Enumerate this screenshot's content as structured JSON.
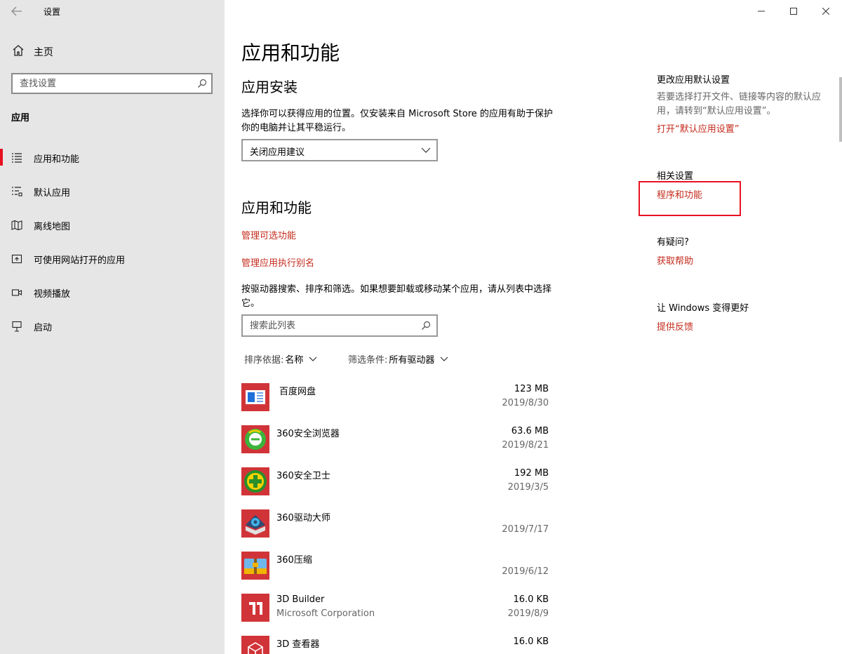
{
  "window": {
    "title": "设置"
  },
  "sidebar": {
    "home_label": "主页",
    "search_placeholder": "查找设置",
    "section_label": "应用",
    "items": [
      {
        "label": "应用和功能",
        "icon": "apps-features-icon",
        "active": true
      },
      {
        "label": "默认应用",
        "icon": "default-apps-icon",
        "active": false
      },
      {
        "label": "离线地图",
        "icon": "offline-maps-icon",
        "active": false
      },
      {
        "label": "可使用网站打开的应用",
        "icon": "apps-for-websites-icon",
        "active": false
      },
      {
        "label": "视频播放",
        "icon": "video-playback-icon",
        "active": false
      },
      {
        "label": "启动",
        "icon": "startup-icon",
        "active": false
      }
    ]
  },
  "main": {
    "title": "应用和功能",
    "install_section": {
      "heading": "应用安装",
      "description": "选择你可以获得应用的位置。仅安装来自 Microsoft Store 的应用有助于保护你的电脑并让其平稳运行。",
      "dropdown_value": "关闭应用建议"
    },
    "apps_section": {
      "heading": "应用和功能",
      "link_optional": "管理可选功能",
      "link_alias": "管理应用执行别名",
      "description": "按驱动器搜索、排序和筛选。如果想要卸载或移动某个应用，请从列表中选择它。",
      "search_placeholder": "搜索此列表",
      "sort_key": "排序依据:",
      "sort_value": "名称",
      "filter_key": "筛选条件:",
      "filter_value": "所有驱动器"
    },
    "apps": [
      {
        "name": "百度网盘",
        "publisher": "",
        "size": "123 MB",
        "date": "2019/8/30",
        "icon": "baidu-netdisk-icon"
      },
      {
        "name": "360安全浏览器",
        "publisher": "",
        "size": "63.6 MB",
        "date": "2019/8/21",
        "icon": "360-browser-icon"
      },
      {
        "name": "360安全卫士",
        "publisher": "",
        "size": "192 MB",
        "date": "2019/3/5",
        "icon": "360-safe-icon"
      },
      {
        "name": "360驱动大师",
        "publisher": "",
        "size": "",
        "date": "2019/7/17",
        "icon": "360-driver-icon"
      },
      {
        "name": "360压缩",
        "publisher": "",
        "size": "",
        "date": "2019/6/12",
        "icon": "360-zip-icon"
      },
      {
        "name": "3D Builder",
        "publisher": "Microsoft Corporation",
        "size": "16.0 KB",
        "date": "2019/8/9",
        "icon": "3d-builder-icon"
      },
      {
        "name": "3D 查看器",
        "publisher": "",
        "size": "16.0 KB",
        "date": "",
        "icon": "3d-viewer-icon"
      }
    ]
  },
  "right": {
    "default_title": "更改应用默认设置",
    "default_desc": "若要选择打开文件、链接等内容的默认应用，请转到“默认应用设置”。",
    "default_link": "打开“默认应用设置”",
    "related_title": "相关设置",
    "related_link": "程序和功能",
    "help_title": "有疑问?",
    "help_link": "获取帮助",
    "feedback_title": "让 Windows 变得更好",
    "feedback_link": "提供反馈"
  },
  "colors": {
    "accent": "#e81123",
    "link": "#c42b1c",
    "sidebar_bg": "#e6e6e6"
  }
}
